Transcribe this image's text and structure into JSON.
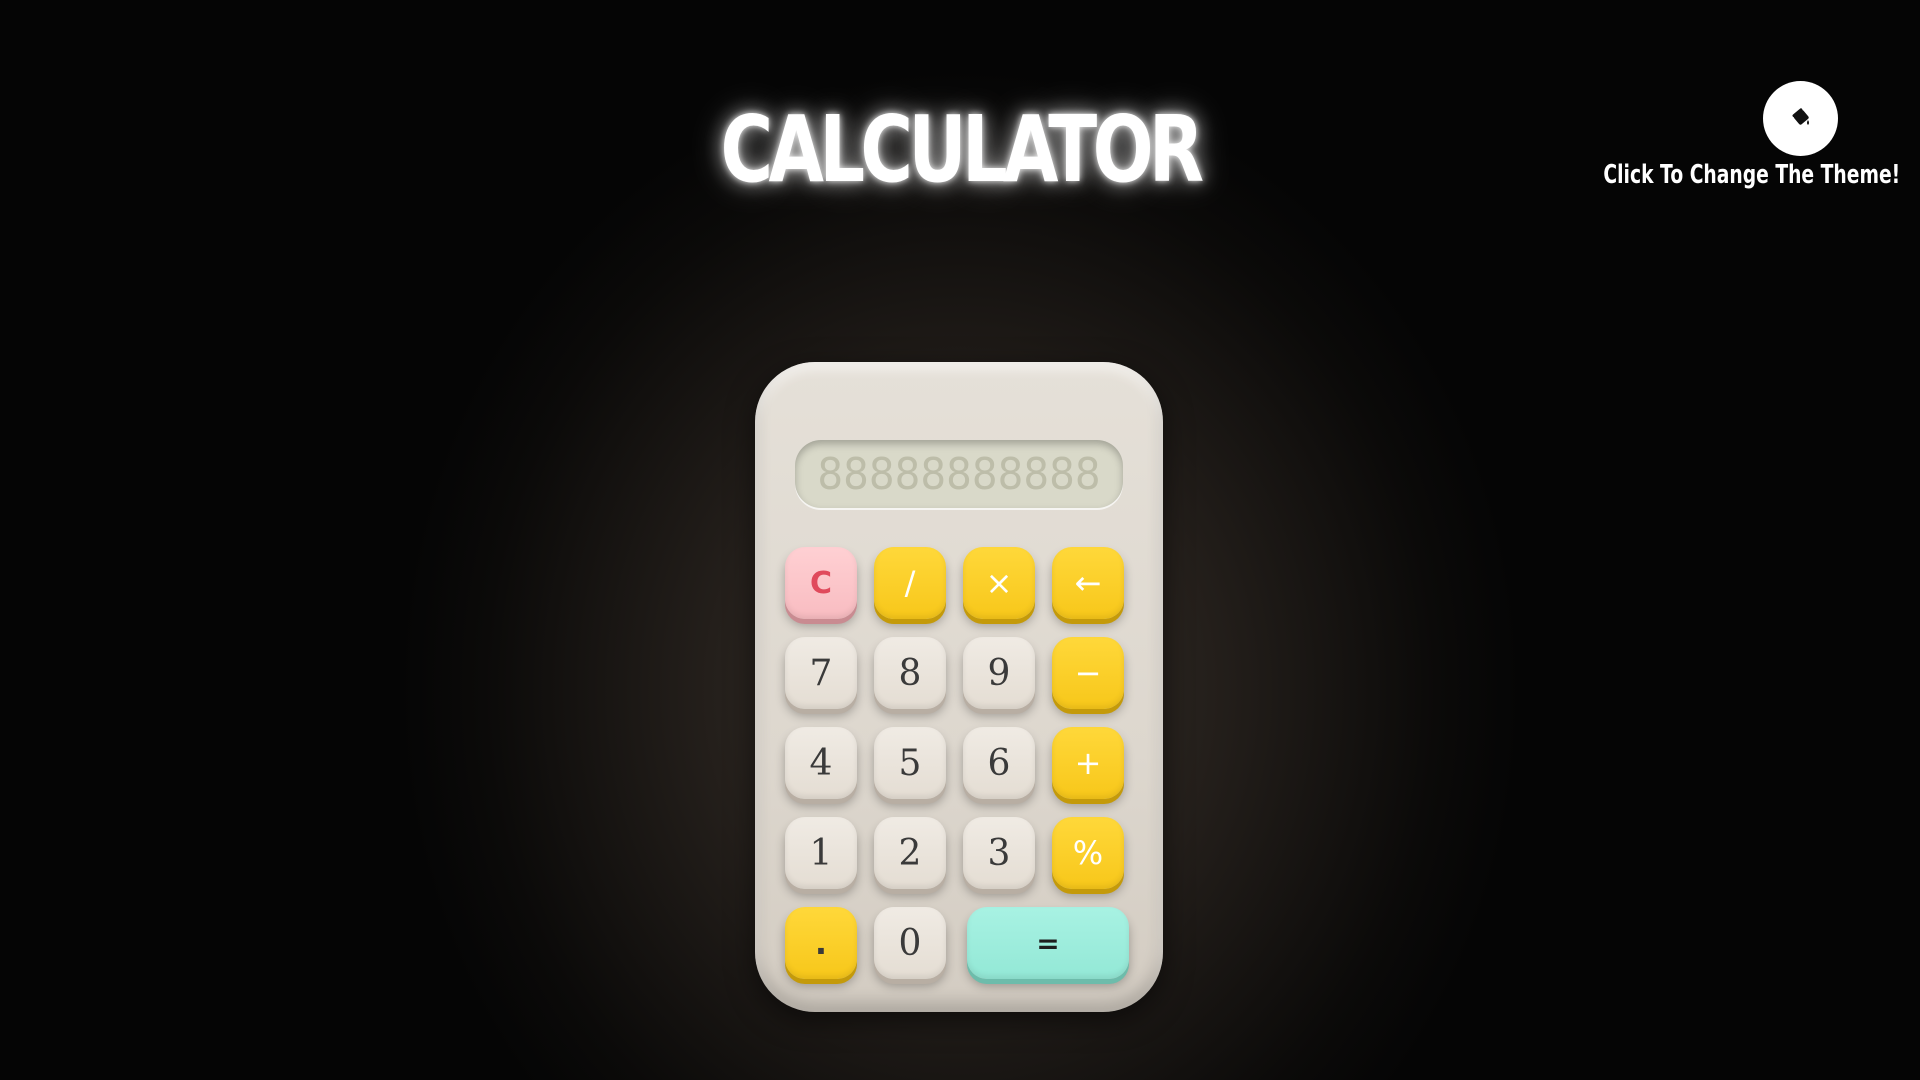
{
  "title": "CALCULATOR",
  "theme": {
    "button_icon": "paint-bucket-icon",
    "label": "Click To Change The Theme!"
  },
  "display": {
    "value": "88888888888"
  },
  "keys": {
    "clear": "C",
    "divide": "/",
    "multiply": "×",
    "backspace": "←",
    "seven": "7",
    "eight": "8",
    "nine": "9",
    "minus": "−",
    "four": "4",
    "five": "5",
    "six": "6",
    "plus": "+",
    "one": "1",
    "two": "2",
    "three": "3",
    "percent": "%",
    "dot": ".",
    "zero": "0",
    "equals": "="
  },
  "colors": {
    "operator": "#f7c71a",
    "clear": "#f8bcc1",
    "equals": "#93e8d6",
    "number": "#e4ddd3",
    "body": "#ddd7ce"
  }
}
